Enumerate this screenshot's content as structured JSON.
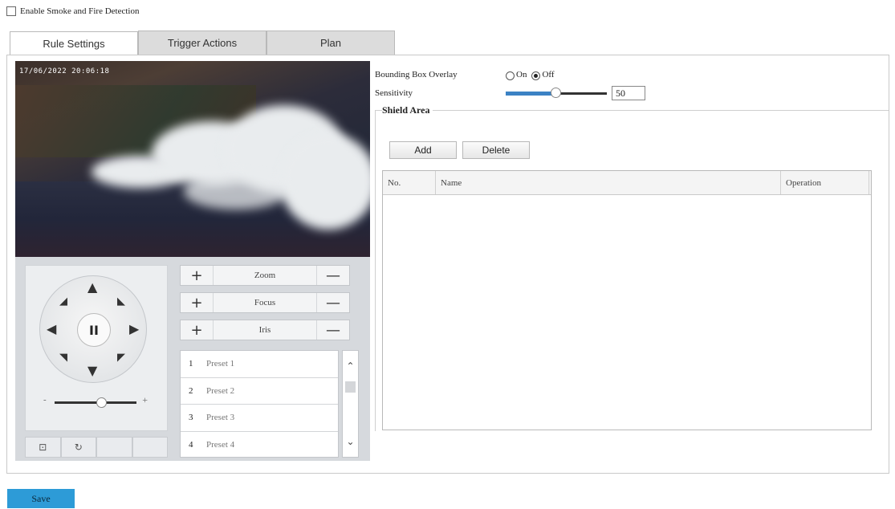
{
  "enable": {
    "label": "Enable Smoke and Fire Detection",
    "checked": false
  },
  "tabs": [
    {
      "label": "Rule Settings",
      "active": true
    },
    {
      "label": "Trigger Actions",
      "active": false
    },
    {
      "label": "Plan",
      "active": false
    }
  ],
  "video": {
    "timestamp": "17/06/2022 20:06:18"
  },
  "ptz": {
    "arrows": {
      "up": "▲",
      "down": "▼",
      "left": "◀",
      "right": "▶",
      "up_left": "◤",
      "up_right": "◥",
      "down_left": "◣",
      "down_right": "◢"
    },
    "center": "II",
    "speed_minus": "-",
    "speed_plus": "+",
    "bottom_icons": [
      "lock-icon",
      "refresh-icon",
      "",
      ""
    ],
    "bottom_glyphs": [
      "⊡",
      "↻",
      "",
      ""
    ]
  },
  "lens": [
    {
      "label": "Zoom",
      "plus": "+",
      "minus": "—"
    },
    {
      "label": "Focus",
      "plus": "+",
      "minus": "—"
    },
    {
      "label": "Iris",
      "plus": "+",
      "minus": "—"
    }
  ],
  "presets": [
    {
      "num": "1",
      "name": "Preset 1"
    },
    {
      "num": "2",
      "name": "Preset 2"
    },
    {
      "num": "3",
      "name": "Preset 3"
    },
    {
      "num": "4",
      "name": "Preset 4"
    }
  ],
  "preset_scroll": {
    "up": "⌃",
    "down": "⌄"
  },
  "bounding_box": {
    "label": "Bounding Box Overlay",
    "on_label": "On",
    "off_label": "Off",
    "selected": "Off"
  },
  "sensitivity": {
    "label": "Sensitivity",
    "value": "50",
    "level_percent": 50
  },
  "shield": {
    "title": "Shield Area",
    "add_label": "Add",
    "delete_label": "Delete",
    "columns": [
      "No.",
      "Name",
      "Operation"
    ]
  },
  "save_label": "Save",
  "colors": {
    "save": "#2d9bd7",
    "slider_fill": "#3b82c4"
  }
}
